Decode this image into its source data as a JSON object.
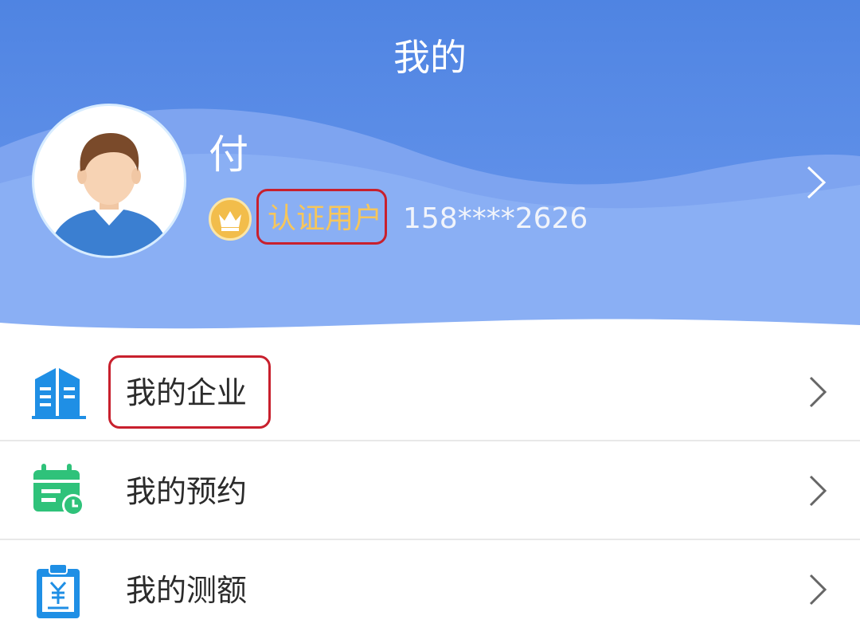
{
  "header": {
    "title": "我的",
    "colors": {
      "top": "#4b7fe0",
      "bottom": "#86aaf2",
      "wave": "#6f98ee"
    }
  },
  "profile": {
    "name": "付",
    "badge_icon": "crown-icon",
    "status": "认证用户",
    "phone": "158****2626",
    "chevron_icon": "chevron-right-icon"
  },
  "menu": {
    "items": [
      {
        "label": "我的企业",
        "icon": "building-icon",
        "icon_color": "#1f8fe5"
      },
      {
        "label": "我的预约",
        "icon": "calendar-clock-icon",
        "icon_color": "#2fc27a"
      },
      {
        "label": "我的测额",
        "icon": "clipboard-yuan-icon",
        "icon_color": "#1f8fe5"
      }
    ]
  },
  "annotation_color": "#c8202d"
}
